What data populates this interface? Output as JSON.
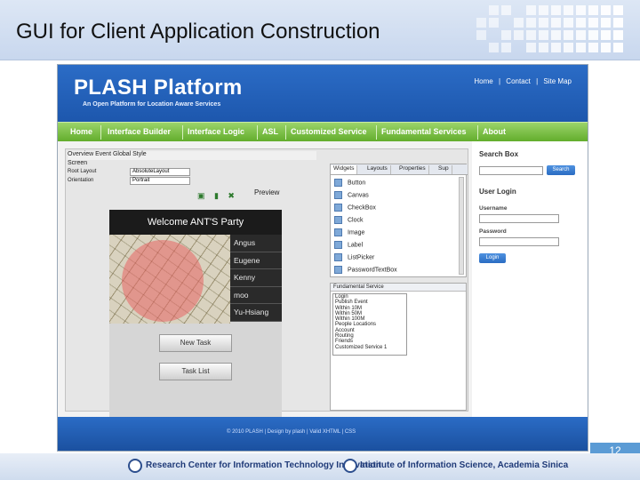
{
  "slide": {
    "title": "GUI for Client Application Construction",
    "page_number": "12"
  },
  "site": {
    "logo": "PLASH Platform",
    "tagline": "An Open Platform for Location Aware Services",
    "top_links": [
      "Home",
      "|",
      "Contact",
      "|",
      "Site Map"
    ],
    "nav": [
      "Home",
      "Interface Builder",
      "Interface Logic",
      "ASL",
      "Customized Service",
      "Fundamental Services",
      "About"
    ],
    "footer": "© 2010 PLASH | Design by plash | Valid XHTML | CSS"
  },
  "builder": {
    "bar1": "Overview  Event  Global  Style",
    "bar2": "Screen",
    "props": [
      {
        "label": "Root Layout",
        "value": "AbsoluteLayout"
      },
      {
        "label": "Orientation",
        "value": "Portrait"
      }
    ],
    "tool_text": "Preview",
    "phone": {
      "title": "Welcome ANT'S Party",
      "names": [
        "Angus",
        "Eugene",
        "Kenny",
        "moo",
        "Yu-Hsiang"
      ],
      "new_task": "New Task",
      "task_list": "Task List"
    },
    "palette": {
      "tabs": [
        "Widgets",
        "Layouts",
        "Properties",
        "Sup"
      ],
      "items": [
        "Button",
        "Canvas",
        "CheckBox",
        "Clock",
        "Image",
        "Label",
        "ListPicker",
        "PasswordTextBox"
      ]
    },
    "fundamental": {
      "title": "Fundamental Service",
      "items": [
        "Login",
        "Publish Event",
        "Within 10M",
        "Within 50M",
        "Within 100M",
        "People Locations",
        "Account",
        "Routing",
        "Friends",
        "Customized Service 1"
      ]
    }
  },
  "sidebar": {
    "search_title": "Search Box",
    "search_button": "Search",
    "login_title": "User Login",
    "username_label": "Username",
    "password_label": "Password",
    "login_button": "Login"
  },
  "bottom": {
    "left_org": "Research Center for Information Technology Innovation",
    "right_org": "Institute of Information Science, Academia Sinica"
  }
}
